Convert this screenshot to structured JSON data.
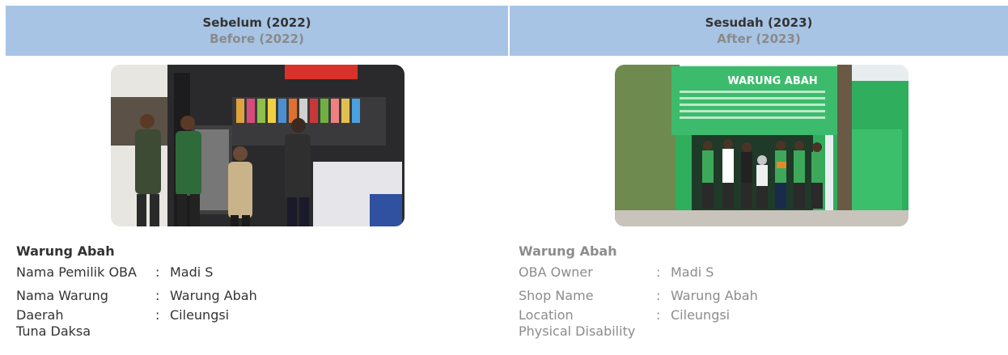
{
  "before": {
    "header_main": "Sebelum (2022)",
    "header_sub": "Before (2022)",
    "photo_alt": "Warung photo before",
    "shop_title": "Warung Abah",
    "rows": [
      {
        "label": "Nama Pemilik OBA",
        "sep": ":",
        "value": "Madi S"
      },
      {
        "label": "Nama Warung",
        "sep": ":",
        "value": "Warung Abah"
      },
      {
        "label": "Daerah",
        "sep": ":",
        "value": "Cileungsi"
      }
    ],
    "extra_line": "Tuna Daksa"
  },
  "after": {
    "header_main": "Sesudah (2023)",
    "header_sub": "After (2023)",
    "sign_text": "WARUNG ABAH",
    "shop_title": "Warung Abah",
    "rows": [
      {
        "label": "OBA Owner",
        "sep": ":",
        "value": "Madi S"
      },
      {
        "label": "Shop Name",
        "sep": ":",
        "value": "Warung Abah"
      },
      {
        "label": "Location",
        "sep": ":",
        "value": "Cileungsi"
      }
    ],
    "extra_line": "Physical Disability"
  },
  "colors": {
    "header_bg": "#a8c4e4",
    "shop_green": "#2fae5d",
    "sign_green": "#3dbb6c"
  }
}
